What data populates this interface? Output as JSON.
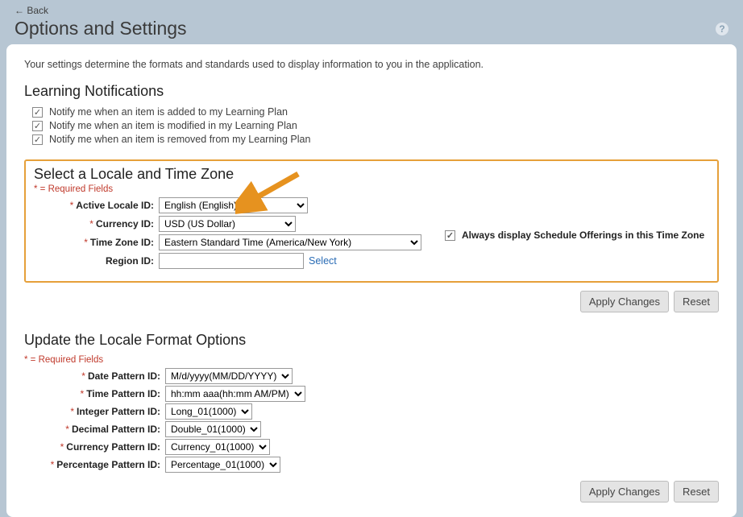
{
  "back_label": "←  Back",
  "page_title": "Options and Settings",
  "intro_text": "Your settings determine the formats and standards used to display information to you in the application.",
  "notifications": {
    "title": "Learning Notifications",
    "item1": "Notify me when an item is added to my Learning Plan",
    "item2": "Notify me when an item is modified in my Learning Plan",
    "item3": "Notify me when an item is removed from my Learning Plan"
  },
  "locale": {
    "title": "Select a Locale and Time Zone",
    "required_note": "* = Required Fields",
    "active_locale_label": "Active Locale ID:",
    "active_locale_value": "English (English)",
    "currency_label": "Currency ID:",
    "currency_value": "USD (US Dollar)",
    "timezone_label": "Time Zone ID:",
    "timezone_value": "Eastern Standard Time (America/New York)",
    "region_label": "Region ID:",
    "region_value": "",
    "select_link": "Select",
    "always_display": "Always display Schedule Offerings in this Time Zone"
  },
  "buttons": {
    "apply": "Apply Changes",
    "reset": "Reset"
  },
  "format": {
    "title": "Update the Locale Format Options",
    "required_note": "* = Required Fields",
    "date_label": "Date Pattern ID:",
    "date_value": "M/d/yyyy(MM/DD/YYYY)",
    "time_label": "Time Pattern ID:",
    "time_value": "hh:mm aaa(hh:mm AM/PM)",
    "integer_label": "Integer Pattern ID:",
    "integer_value": "Long_01(1000)",
    "decimal_label": "Decimal Pattern ID:",
    "decimal_value": "Double_01(1000)",
    "currency_label": "Currency Pattern ID:",
    "currency_value": "Currency_01(1000)",
    "percentage_label": "Percentage Pattern ID:",
    "percentage_value": "Percentage_01(1000)"
  }
}
